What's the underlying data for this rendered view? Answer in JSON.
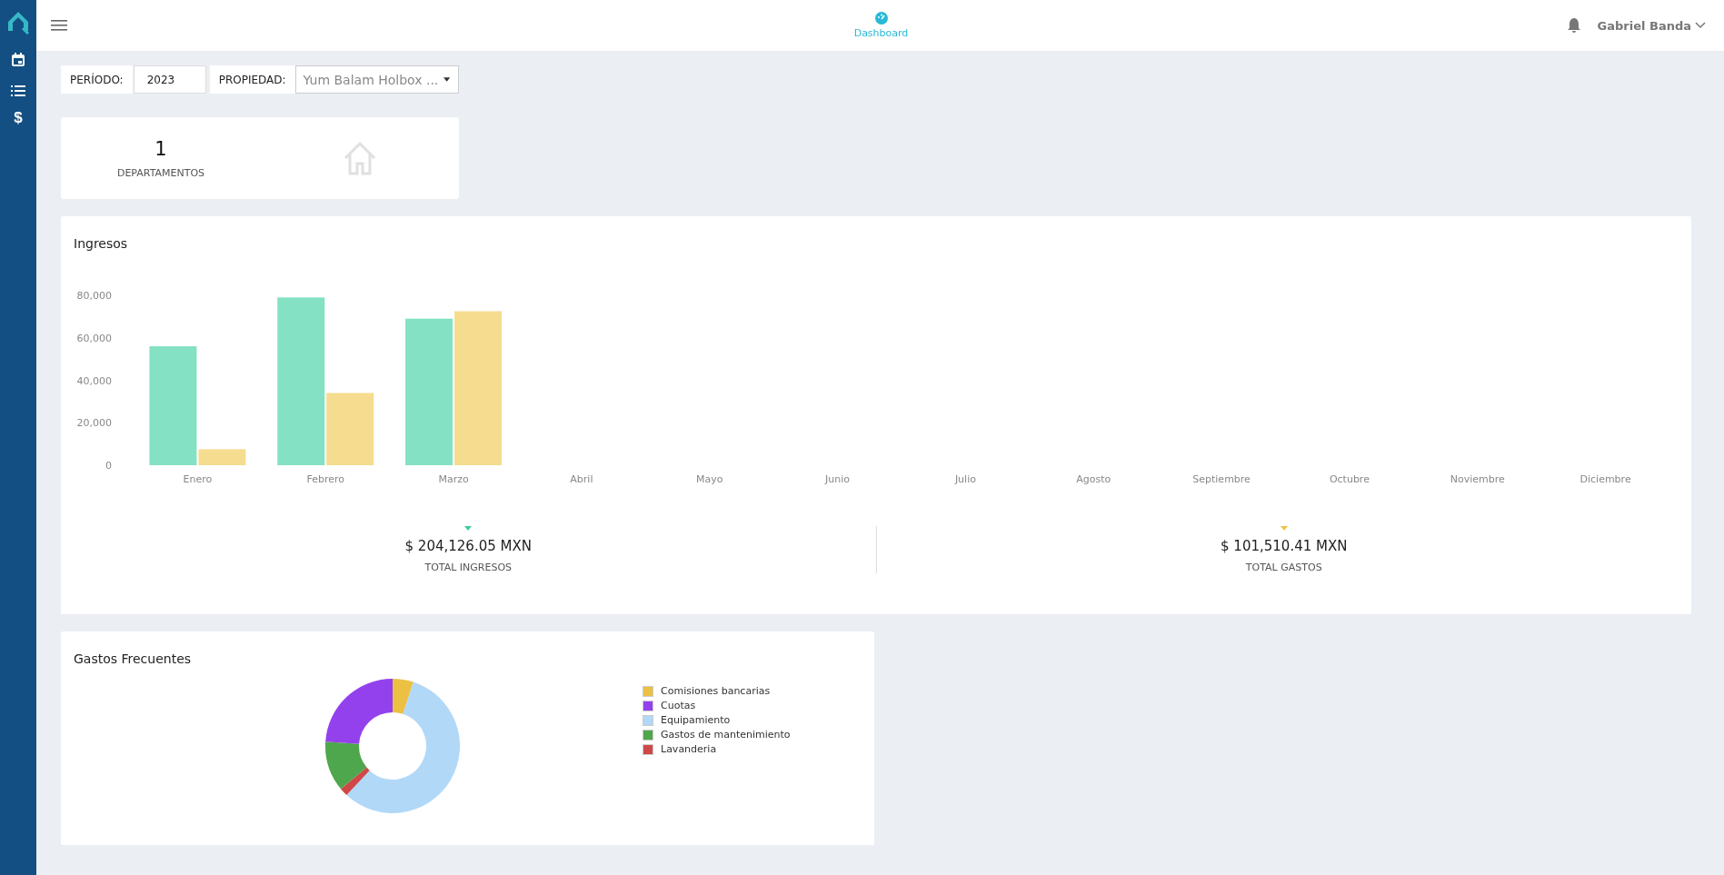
{
  "sidebar": {
    "dollar_icon": "$"
  },
  "header": {
    "tab": "Dashboard",
    "user": "Gabriel Banda"
  },
  "filters": {
    "period_label": "PERÍODO:",
    "period_value": "2023",
    "property_label": "PROPIEDAD:",
    "property_value": "Yum Balam Holbox ..."
  },
  "kpi": {
    "value": "1",
    "label": "DEPARTAMENTOS"
  },
  "ingresos": {
    "title": "Ingresos",
    "chart_data": {
      "type": "bar",
      "categories": [
        "Enero",
        "Febrero",
        "Marzo",
        "Abril",
        "Mayo",
        "Junio",
        "Julio",
        "Agosto",
        "Septiembre",
        "Octubre",
        "Noviembre",
        "Diciembre"
      ],
      "series": [
        {
          "color": "#84e1c4",
          "values": [
            56000,
            79000,
            69000,
            null,
            null,
            null,
            null,
            null,
            null,
            null,
            null,
            null
          ]
        },
        {
          "color": "#f5dc8e",
          "values": [
            7500,
            34000,
            72500,
            null,
            null,
            null,
            null,
            null,
            null,
            null,
            null,
            null
          ]
        }
      ],
      "ylim": [
        0,
        80000
      ],
      "yticks": [
        {
          "value": 0,
          "label": "0"
        },
        {
          "value": 20000,
          "label": "20,000"
        },
        {
          "value": 40000,
          "label": "40,000"
        },
        {
          "value": 60000,
          "label": "60,000"
        },
        {
          "value": 80000,
          "label": "80,000"
        }
      ]
    },
    "totals": [
      {
        "amount": "$ 204,126.05 MXN",
        "label": "TOTAL INGRESOS",
        "color": "#3ecf9f"
      },
      {
        "amount": "$ 101,510.41 MXN",
        "label": "TOTAL GASTOS",
        "color": "#f0c445"
      }
    ]
  },
  "gastos": {
    "title": "Gastos Frecuentes",
    "legend": [
      {
        "label": "Comisiones bancarias",
        "color": "#ecc043"
      },
      {
        "label": "Cuotas",
        "color": "#9341ed"
      },
      {
        "label": "Equipamiento",
        "color": "#b1d8f7"
      },
      {
        "label": "Gastos de mantenimiento",
        "color": "#4ea64d"
      },
      {
        "label": "Lavanderia",
        "color": "#cf4847"
      }
    ]
  }
}
